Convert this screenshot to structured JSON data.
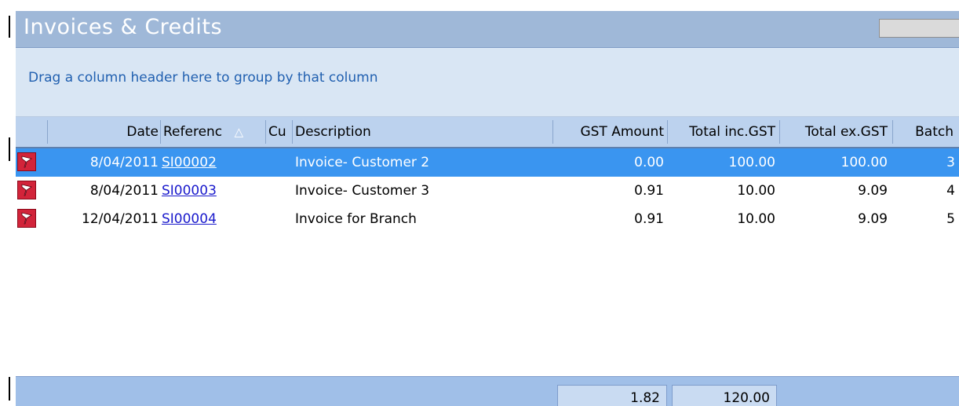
{
  "panel": {
    "title": "Invoices & Credits",
    "group_hint": "Drag a column header here to group by that column"
  },
  "columns": {
    "date": "Date",
    "reference": "Referenc",
    "reference_sort": "△",
    "customer": "Cu",
    "description": "Description",
    "gst": "GST Amount",
    "total_inc": "Total inc.GST",
    "total_ex": "Total ex.GST",
    "batch": "Batch"
  },
  "rows": [
    {
      "date": "8/04/2011",
      "reference": "SI00002",
      "description": "Invoice- Customer 2",
      "gst": "0.00",
      "total_inc": "100.00",
      "total_ex": "100.00",
      "batch": "3",
      "selected": true
    },
    {
      "date": "8/04/2011",
      "reference": "SI00003",
      "description": "Invoice- Customer 3",
      "gst": "0.91",
      "total_inc": "10.00",
      "total_ex": "9.09",
      "batch": "4",
      "selected": false
    },
    {
      "date": "12/04/2011",
      "reference": "SI00004",
      "description": "Invoice for Branch",
      "gst": "0.91",
      "total_inc": "10.00",
      "total_ex": "9.09",
      "batch": "5",
      "selected": false
    }
  ],
  "totals": {
    "gst": "1.82",
    "total_inc": "120.00"
  },
  "colors": {
    "selection": "#3a95f0",
    "flag": "#d2243a",
    "link": "#1a1acc"
  },
  "icons": {
    "row_icon": "red-flag-icon"
  }
}
